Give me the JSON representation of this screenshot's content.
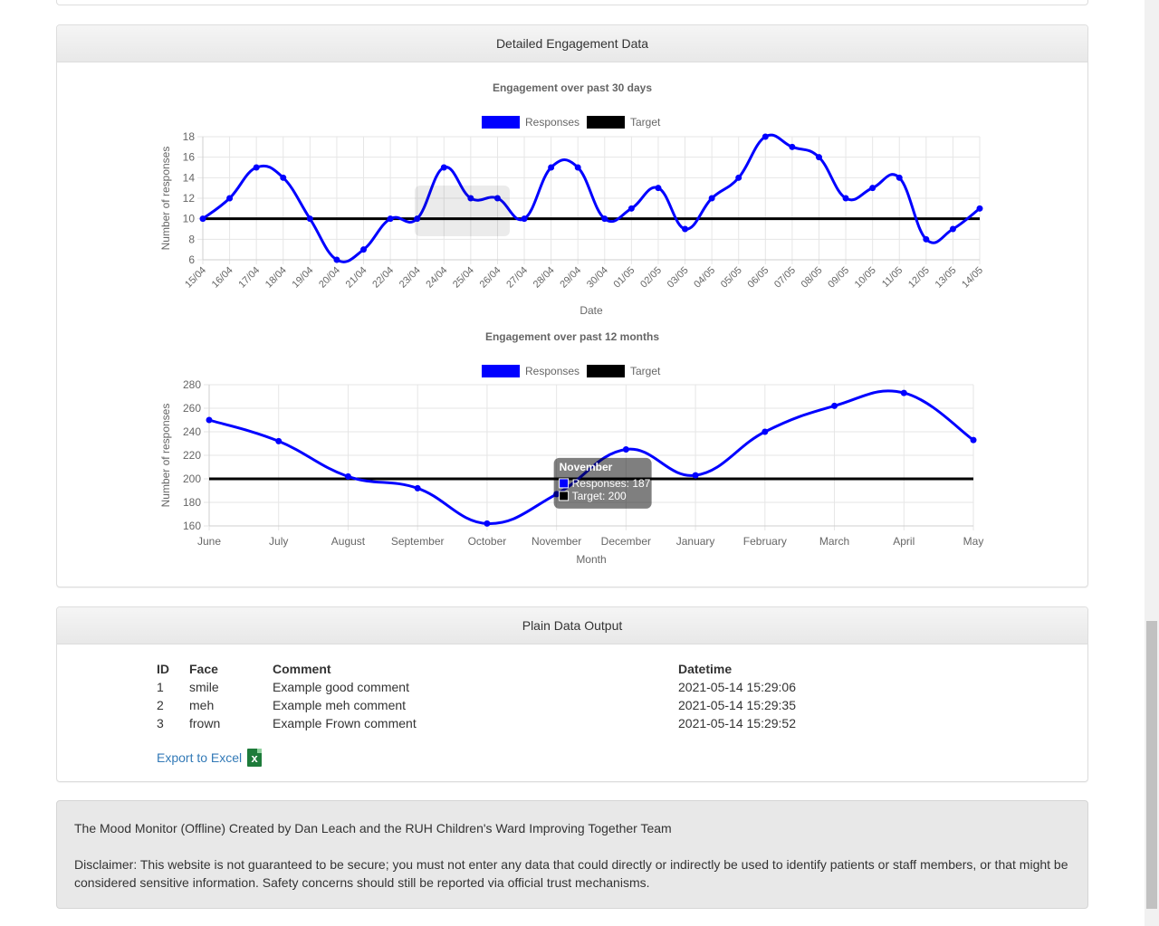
{
  "engagement_panel": {
    "title": "Detailed Engagement Data"
  },
  "chart_data": [
    {
      "type": "line",
      "title": "Engagement over past 30 days",
      "xlabel": "Date",
      "ylabel": "Number of responses",
      "ylim": [
        6,
        18
      ],
      "yticks": [
        6,
        8,
        10,
        12,
        14,
        16,
        18
      ],
      "categories": [
        "15/04",
        "16/04",
        "17/04",
        "18/04",
        "19/04",
        "20/04",
        "21/04",
        "22/04",
        "23/04",
        "24/04",
        "25/04",
        "26/04",
        "27/04",
        "28/04",
        "29/04",
        "30/04",
        "01/05",
        "02/05",
        "03/05",
        "04/05",
        "05/05",
        "06/05",
        "07/05",
        "08/05",
        "09/05",
        "10/05",
        "11/05",
        "12/05",
        "13/05",
        "14/05"
      ],
      "series": [
        {
          "name": "Responses",
          "color": "#0000ff",
          "values": [
            10,
            12,
            15,
            14,
            10,
            6,
            7,
            10,
            10,
            15,
            12,
            12,
            10,
            15,
            15,
            10,
            11,
            13,
            9,
            12,
            14,
            18,
            17,
            16,
            12,
            13,
            14,
            8,
            9,
            11
          ]
        },
        {
          "name": "Target",
          "color": "#000000",
          "values": [
            10,
            10,
            10,
            10,
            10,
            10,
            10,
            10,
            10,
            10,
            10,
            10,
            10,
            10,
            10,
            10,
            10,
            10,
            10,
            10,
            10,
            10,
            10,
            10,
            10,
            10,
            10,
            10,
            10,
            10
          ]
        }
      ],
      "legend": "top",
      "grid": true
    },
    {
      "type": "line",
      "title": "Engagement over past 12 months",
      "xlabel": "Month",
      "ylabel": "Number of responses",
      "ylim": [
        160,
        280
      ],
      "yticks": [
        160,
        180,
        200,
        220,
        240,
        260,
        280
      ],
      "categories": [
        "June",
        "July",
        "August",
        "September",
        "October",
        "November",
        "December",
        "January",
        "February",
        "March",
        "April",
        "May"
      ],
      "series": [
        {
          "name": "Responses",
          "color": "#0000ff",
          "values": [
            250,
            232,
            202,
            192,
            162,
            187,
            225,
            203,
            240,
            262,
            273,
            233
          ]
        },
        {
          "name": "Target",
          "color": "#000000",
          "values": [
            200,
            200,
            200,
            200,
            200,
            200,
            200,
            200,
            200,
            200,
            200,
            200
          ]
        }
      ],
      "legend": "top",
      "grid": true,
      "tooltip": {
        "title": "November",
        "lines": [
          "Responses: 187",
          "Target: 200"
        ]
      }
    }
  ],
  "plain_panel": {
    "title": "Plain Data Output",
    "headers": {
      "id": "ID",
      "face": "Face",
      "comment": "Comment",
      "datetime": "Datetime"
    },
    "rows": [
      {
        "id": "1",
        "face": "smile",
        "comment": "Example good comment",
        "datetime": "2021-05-14 15:29:06"
      },
      {
        "id": "2",
        "face": "meh",
        "comment": "Example meh comment",
        "datetime": "2021-05-14 15:29:35"
      },
      {
        "id": "3",
        "face": "frown",
        "comment": "Example Frown comment",
        "datetime": "2021-05-14 15:29:52"
      }
    ],
    "export_label": "Export to Excel",
    "export_icon": "excel-file-icon"
  },
  "footer": {
    "credit": "The Mood Monitor (Offline) Created by Dan Leach and the RUH Children's Ward Improving Together Team",
    "disclaimer": "Disclaimer: This website is not guaranteed to be secure; you must not enter any data that could directly or indirectly be used to identify patients or staff members, or that might be considered sensitive information. Safety concerns should still be reported via official trust mechanisms."
  }
}
